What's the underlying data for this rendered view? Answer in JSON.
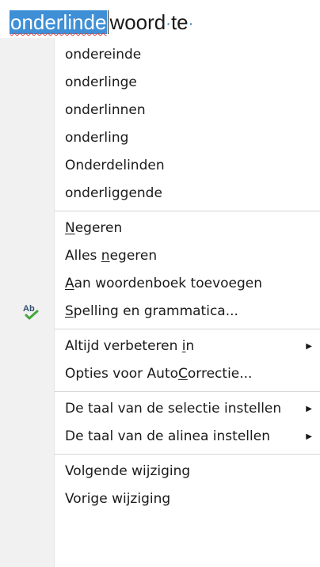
{
  "document": {
    "misspelled_word": "onderlinde",
    "rest_words": [
      "woord",
      "te"
    ]
  },
  "context_menu": {
    "suggestions": [
      "ondereinde",
      "onderlinge",
      "onderlinnen",
      "onderling",
      "Onderdelinden",
      "onderliggende"
    ],
    "proofing": {
      "ignore": {
        "pre": "",
        "accel": "N",
        "post": "egeren"
      },
      "ignore_all": {
        "pre": "Alles ",
        "accel": "n",
        "post": "egeren"
      },
      "add_to_dictionary": {
        "pre": "",
        "accel": "A",
        "post": "an woordenboek toevoegen"
      },
      "spelling_grammar": {
        "pre": "",
        "accel": "S",
        "post": "pelling en grammatica..."
      }
    },
    "autocorrect": {
      "always_correct": {
        "pre": "Altijd verbeteren ",
        "accel": "i",
        "post": "n"
      },
      "options": {
        "pre": "Opties voor Auto",
        "accel": "C",
        "post": "orrectie..."
      }
    },
    "language": {
      "selection_language": "De taal van de selectie instellen",
      "paragraph_language": "De taal van de alinea instellen"
    },
    "changes": {
      "next_change": "Volgende wijziging",
      "previous_change": "Vorige wijziging"
    },
    "icons": {
      "spelling": "spelling-check-icon",
      "submenu": "submenu-arrow-icon"
    }
  }
}
